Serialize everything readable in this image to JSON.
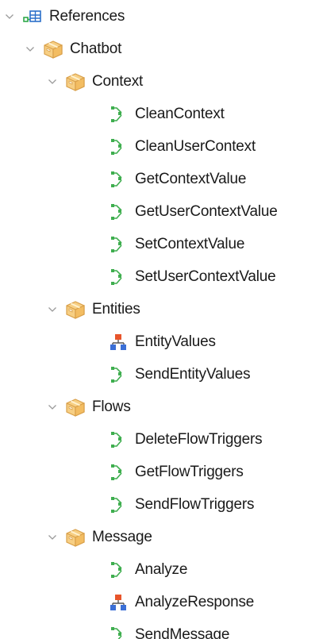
{
  "tree": {
    "root": {
      "label": "References",
      "icon": "references-icon",
      "expanded": true
    },
    "module": {
      "label": "Chatbot",
      "icon": "package-icon",
      "expanded": true
    },
    "folders": [
      {
        "label": "Context",
        "icon": "package-icon",
        "expanded": true,
        "items": [
          {
            "label": "CleanContext",
            "icon": "procedure-icon"
          },
          {
            "label": "CleanUserContext",
            "icon": "procedure-icon"
          },
          {
            "label": "GetContextValue",
            "icon": "procedure-icon"
          },
          {
            "label": "GetUserContextValue",
            "icon": "procedure-icon"
          },
          {
            "label": "SetContextValue",
            "icon": "procedure-icon"
          },
          {
            "label": "SetUserContextValue",
            "icon": "procedure-icon"
          }
        ]
      },
      {
        "label": "Entities",
        "icon": "package-icon",
        "expanded": true,
        "items": [
          {
            "label": "EntityValues",
            "icon": "sdt-icon"
          },
          {
            "label": "SendEntityValues",
            "icon": "procedure-icon"
          }
        ]
      },
      {
        "label": "Flows",
        "icon": "package-icon",
        "expanded": true,
        "items": [
          {
            "label": "DeleteFlowTriggers",
            "icon": "procedure-icon"
          },
          {
            "label": "GetFlowTriggers",
            "icon": "procedure-icon"
          },
          {
            "label": "SendFlowTriggers",
            "icon": "procedure-icon"
          }
        ]
      },
      {
        "label": "Message",
        "icon": "package-icon",
        "expanded": true,
        "items": [
          {
            "label": "Analyze",
            "icon": "procedure-icon"
          },
          {
            "label": "AnalyzeResponse",
            "icon": "sdt-icon"
          },
          {
            "label": "SendMessage",
            "icon": "procedure-icon"
          }
        ]
      }
    ]
  }
}
